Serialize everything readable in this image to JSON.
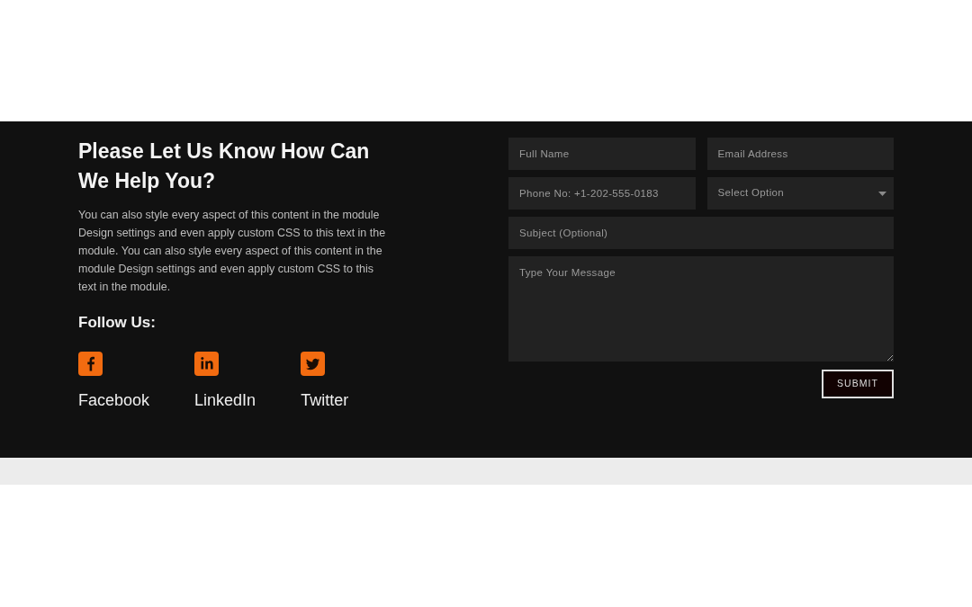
{
  "contact": {
    "heading": "Please Let Us Know How Can We Help You?",
    "description": "You can also style every aspect of this content in the module Design settings and even apply custom CSS to this text in the module. You can also style every aspect of this content in the module Design settings and even apply custom CSS to this text in the module.",
    "follow_title": "Follow Us:",
    "social_links": [
      {
        "kind": "facebook",
        "label": "Facebook"
      },
      {
        "kind": "linkedin",
        "label": "LinkedIn"
      },
      {
        "kind": "twitter",
        "label": "Twitter"
      }
    ]
  },
  "form": {
    "fields": [
      {
        "kind": "text",
        "placeholder": "Full Name"
      },
      {
        "kind": "text",
        "placeholder": "Email Address"
      },
      {
        "kind": "text",
        "placeholder": "Phone No: +1-202-555-0183"
      },
      {
        "kind": "select",
        "placeholder": "Select Option"
      },
      {
        "kind": "wide",
        "placeholder": "Subject (Optional)"
      },
      {
        "kind": "textarea",
        "placeholder": "Type Your Message"
      }
    ],
    "submit": "SUBMIT"
  }
}
